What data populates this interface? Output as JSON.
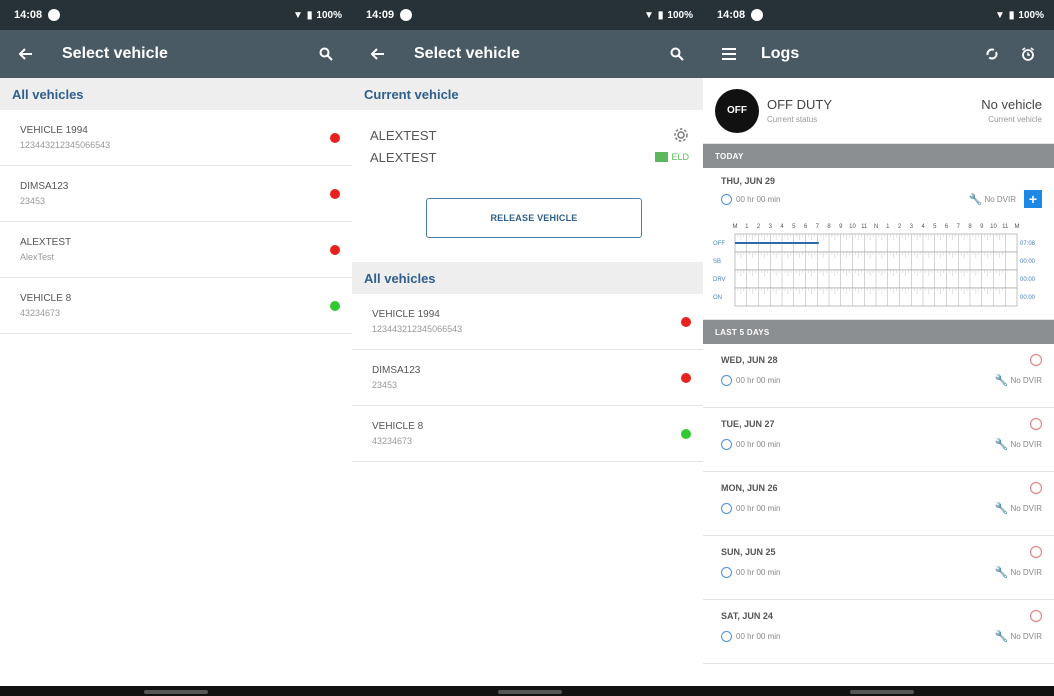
{
  "panels": [
    {
      "status": {
        "time": "14:08",
        "battery": "100%"
      },
      "title": "Select vehicle",
      "all_header": "All vehicles",
      "vehicles": [
        {
          "name": "VEHICLE 1994",
          "sub": "123443212345066543",
          "status": "red"
        },
        {
          "name": "DIMSA123",
          "sub": "23453",
          "status": "red"
        },
        {
          "name": "ALEXTEST",
          "sub": "AlexTest",
          "status": "red"
        },
        {
          "name": "VEHICLE 8",
          "sub": "43234673",
          "status": "green"
        }
      ]
    },
    {
      "status": {
        "time": "14:09",
        "battery": "100%"
      },
      "title": "Select vehicle",
      "current_header": "Current vehicle",
      "current": {
        "name": "ALEXTEST",
        "sub": "ALEXTEST",
        "eld": "ELD"
      },
      "release_label": "RELEASE VEHICLE",
      "all_header": "All vehicles",
      "vehicles": [
        {
          "name": "VEHICLE 1994",
          "sub": "123443212345066543",
          "status": "red"
        },
        {
          "name": "DIMSA123",
          "sub": "23453",
          "status": "red"
        },
        {
          "name": "VEHICLE 8",
          "sub": "43234673",
          "status": "green"
        }
      ]
    },
    {
      "status": {
        "time": "14:08",
        "battery": "100%"
      },
      "title": "Logs",
      "off_label": "OFF",
      "duty_status": "OFF DUTY",
      "duty_caption": "Current status",
      "vehicle_status": "No vehicle",
      "vehicle_caption": "Current vehicle",
      "today_header": "TODAY",
      "today": {
        "date": "THU, JUN 29",
        "duration": "00 hr 00 min",
        "dvir": "No DVIR"
      },
      "grid_hours": [
        "M",
        "1",
        "2",
        "3",
        "4",
        "5",
        "6",
        "7",
        "8",
        "9",
        "10",
        "11",
        "N",
        "1",
        "2",
        "3",
        "4",
        "5",
        "6",
        "7",
        "8",
        "9",
        "10",
        "11",
        "M"
      ],
      "grid_rows": [
        "OFF",
        "SB",
        "DRV",
        "ON"
      ],
      "grid_totals": [
        "07:08",
        "00:00",
        "00:00",
        "00:00"
      ],
      "last_header": "LAST 5 DAYS",
      "days": [
        {
          "date": "WED, JUN 28",
          "duration": "00 hr 00 min",
          "dvir": "No DVIR"
        },
        {
          "date": "TUE, JUN 27",
          "duration": "00 hr 00 min",
          "dvir": "No DVIR"
        },
        {
          "date": "MON, JUN 26",
          "duration": "00 hr 00 min",
          "dvir": "No DVIR"
        },
        {
          "date": "SUN, JUN 25",
          "duration": "00 hr 00 min",
          "dvir": "No DVIR"
        },
        {
          "date": "SAT, JUN 24",
          "duration": "00 hr 00 min",
          "dvir": "No DVIR"
        }
      ]
    }
  ],
  "colors": {
    "appbar": "#4a5a65",
    "statusbar": "#263238",
    "accent": "#2f5f8a",
    "online": "#32c832",
    "offline": "#e8211c"
  },
  "icons": [
    "back-arrow-icon",
    "search-icon",
    "menu-icon",
    "sync-icon",
    "alarm-icon",
    "gear-icon",
    "clock-icon",
    "wrench-icon",
    "plus-icon",
    "warning-icon"
  ]
}
